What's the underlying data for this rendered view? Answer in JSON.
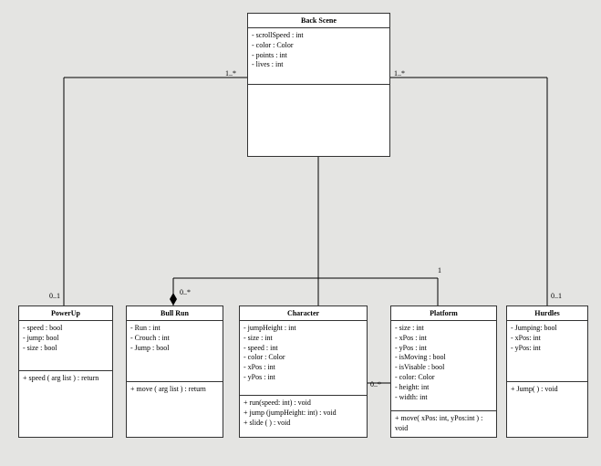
{
  "classes": {
    "backScene": {
      "name": "Back Scene",
      "attrs": "- scrollSpeed : int\n- color : Color\n- points : int\n- lives : int",
      "ops": ""
    },
    "powerUp": {
      "name": "PowerUp",
      "attrs": "- speed : bool\n- jump: bool\n- size : bool",
      "ops": "+ speed ( arg list ) : return"
    },
    "bullRun": {
      "name": "Bull Run",
      "attrs": "- Run : int\n- Crouch : int\n- Jump : bool",
      "ops": "+ move ( arg list ) : return"
    },
    "character": {
      "name": "Character",
      "attrs": "- jumpHeight : int\n- size : int\n- speed : int\n- color : Color\n- xPos : int\n- yPos : int",
      "ops": "+ run(speed: int) : void\n+ jump (jumpHeight: int) : void\n+ slide ( ) : void"
    },
    "platform": {
      "name": "Platform",
      "attrs": "- size : int\n- xPos : int\n- yPos : int\n- isMoving : bool\n- isVisable : bool\n- color: Color\n- height: int\n- width: int",
      "ops": "+ move( xPos: int, yPos:int ) : void"
    },
    "hurdles": {
      "name": "Hurdles",
      "attrs": "- Jumping: bool\n- xPos: int\n- yPos: int",
      "ops": "+ Jump( ) : void"
    }
  },
  "multiplicities": {
    "bsLeft": "1..*",
    "bsRight": "1..*",
    "powerUp": "0..1",
    "bullRun": "0..*",
    "charTop": "1",
    "charPlat": "0..*",
    "hurdles": "0..1"
  }
}
